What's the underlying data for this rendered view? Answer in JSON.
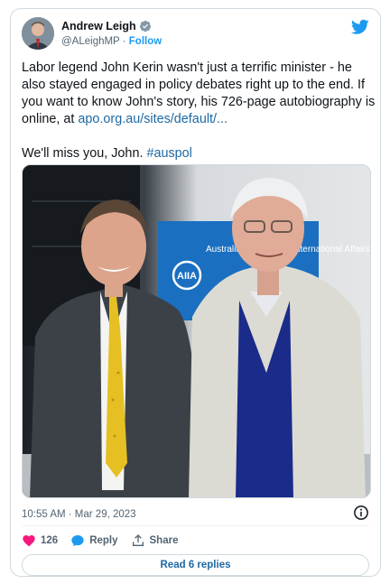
{
  "author": {
    "name": "Andrew Leigh",
    "handle": "@ALeighMP",
    "follow_label": "Follow"
  },
  "tweet": {
    "text_before_link": "Labor legend John Kerin wasn't just a terrific minister - he also stayed engaged in policy debates right up to the end. If you want to know John's story, his 726-page autobiography is online, at ",
    "link": "apo.org.au/sites/default/...",
    "text_second_para": "\n\nWe'll miss you, John. ",
    "hashtag": "#auspol"
  },
  "media": {
    "banner_text": "Australian Institute of International Affairs",
    "banner_logo": "AIIA"
  },
  "timestamp": "10:55 AM · Mar 29, 2023",
  "actions": {
    "like_count": "126",
    "reply_label": "Reply",
    "share_label": "Share"
  },
  "read_replies_label": "Read 6 replies",
  "colors": {
    "accent": "#1d9bf0",
    "like": "#f91880"
  }
}
